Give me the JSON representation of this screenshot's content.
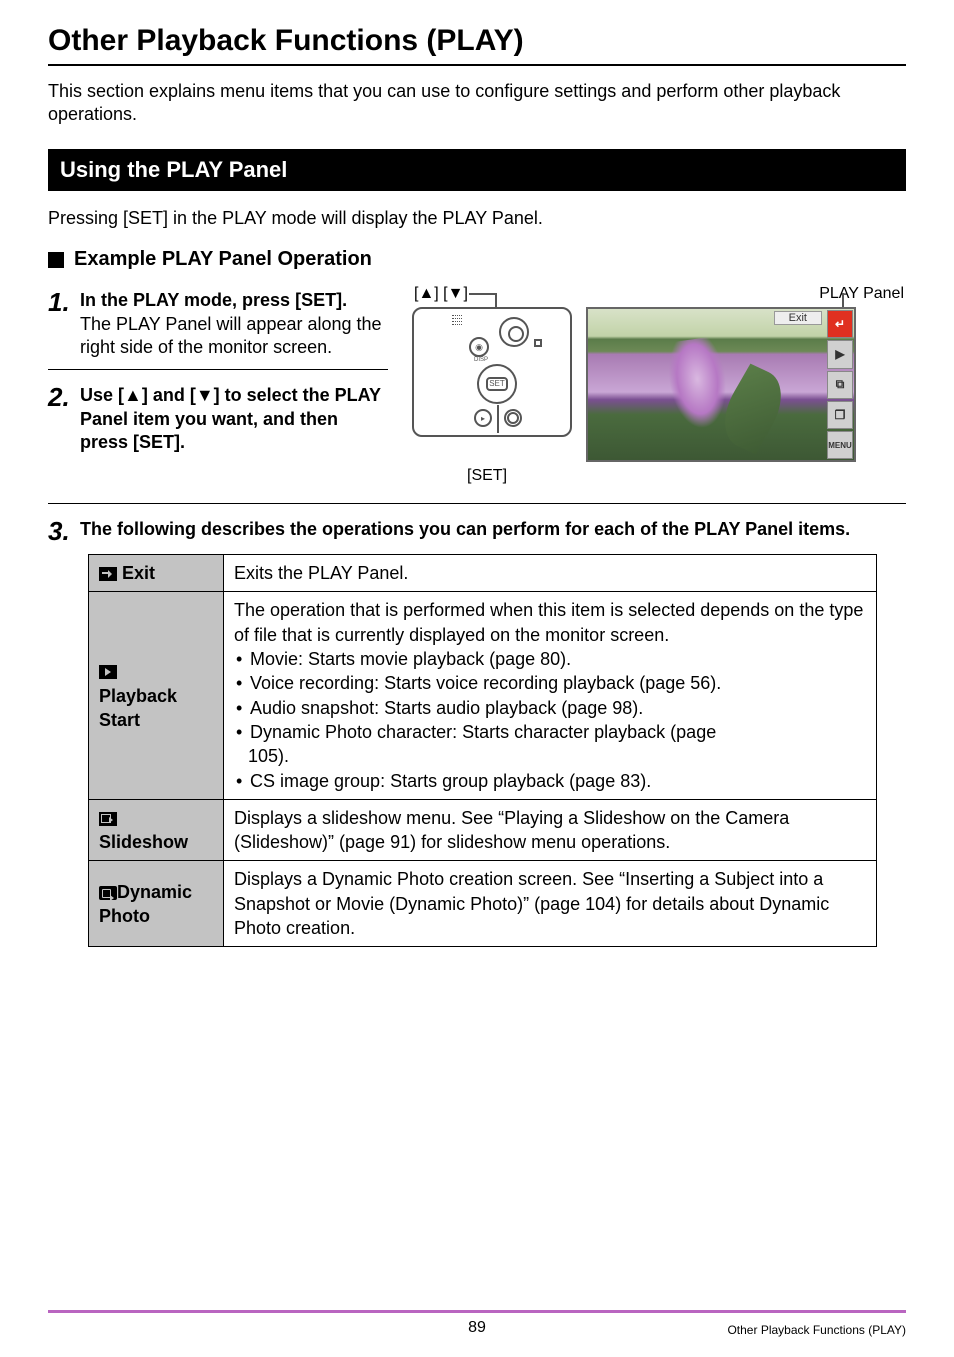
{
  "chapter_title": "Other Playback Functions (PLAY)",
  "intro": "This section explains menu items that you can use to configure settings and perform other playback operations.",
  "section_heading": "Using the PLAY Panel",
  "section_intro": "Pressing [SET] in the PLAY mode will display the PLAY Panel.",
  "example_heading": "Example PLAY Panel Operation",
  "steps": {
    "s1": {
      "num": "1.",
      "head": "In the PLAY mode, press [SET].",
      "sub": "The PLAY Panel will appear along the right side of the monitor screen."
    },
    "s2": {
      "num": "2.",
      "head": "Use [▲] and [▼] to select the PLAY Panel item you want, and then press [SET]."
    },
    "s3": {
      "num": "3.",
      "head": "The following describes the operations you can perform for each of the PLAY Panel items."
    }
  },
  "diagram": {
    "arrows_label": "[▲] [▼]",
    "panel_label": "PLAY Panel",
    "set_label": "[SET]",
    "screen_exit": "Exit",
    "panel_items": {
      "return": "↵",
      "play": "▶",
      "slide": "⧉",
      "dyn": "❐",
      "menu": "MENU"
    }
  },
  "table": {
    "exit": {
      "label": "Exit",
      "desc": "Exits the PLAY Panel."
    },
    "playback": {
      "label_l1": "Playback",
      "label_l2": "Start",
      "intro": "The operation that is performed when this item is selected depends on the type of file that is currently displayed on the monitor screen.",
      "b1": "Movie: Starts movie playback (page 80).",
      "b2": "Voice recording: Starts voice recording playback (page 56).",
      "b3": "Audio snapshot: Starts audio playback (page 98).",
      "b4a": "Dynamic Photo character: Starts character playback (page",
      "b4b": "105).",
      "b5": "CS image group: Starts group playback (page 83)."
    },
    "slideshow": {
      "label": "Slideshow",
      "desc": "Displays a slideshow menu. See “Playing a Slideshow on the Camera (Slideshow)” (page 91) for slideshow menu operations."
    },
    "dynamic": {
      "label_l1": "Dynamic",
      "label_l2": "Photo",
      "desc": "Displays a Dynamic Photo creation screen. See “Inserting a Subject into a Snapshot or Movie (Dynamic Photo)” (page 104) for details about Dynamic Photo creation."
    }
  },
  "footer": {
    "page": "89",
    "chapter": "Other Playback Functions (PLAY)"
  }
}
